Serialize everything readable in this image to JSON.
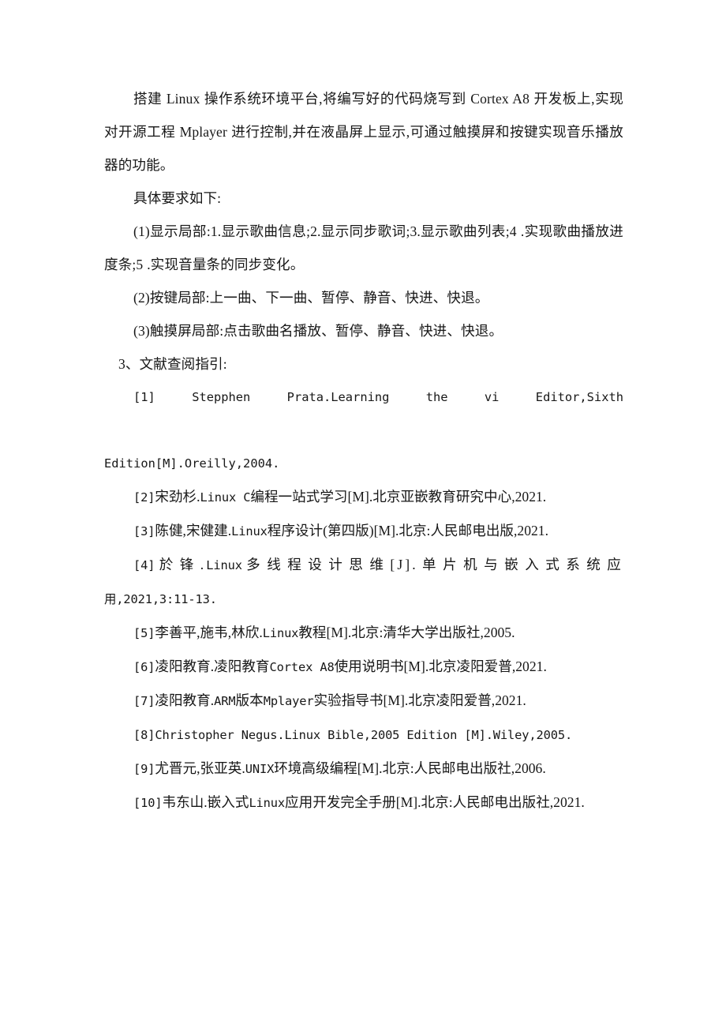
{
  "document": {
    "type": "academic-task-specification",
    "language": "zh-CN",
    "page_background": "#ffffff",
    "text_color": "#171717"
  },
  "body": {
    "intro_paragraph": "搭建 Linux 操作系统环境平台,将编写好的代码烧写到 Cortex A8 开发板上,实现对开源工程 Mplayer 进行控制,并在液晶屏上显示,可通过触摸屏和按键实现音乐播放器的功能。",
    "requirements_heading": "具体要求如下:",
    "requirements": [
      "(1)显示局部:1.显示歌曲信息;2.显示同步歌词;3.显示歌曲列表;4 .实现歌曲播放进度条;5 .实现音量条的同步变化。",
      "(2)按键局部:上一曲、下一曲、暂停、静音、快进、快退。",
      "(3)触摸屏局部:点击歌曲名播放、暂停、静音、快进、快退。"
    ],
    "references_heading": "3、文献查阅指引:",
    "references": [
      {
        "marker": "[1]",
        "line1": "Stepphen Prata.Learning the vi Editor,Sixth",
        "line2": "Edition[M].Oreilly,2004.",
        "justified_wide": true
      },
      {
        "marker": "[2]",
        "text_cjk_a": "宋劲杉.",
        "text_latin": "Linux C",
        "text_cjk_b": "编程一站式学习[M].北京亚嵌教育研究中心,2021."
      },
      {
        "marker": "[3]",
        "text_cjk_a": "陈健,宋健建.",
        "text_latin": "Linux",
        "text_cjk_b": "程序设计(第四版)[M].北京:人民邮电出版,2021."
      },
      {
        "marker": "[4]",
        "line1_cjk_a": "於锋.",
        "line1_latin": "Linux",
        "line1_cjk_b": "多线程设计思维[J].单片机与嵌入式系统应",
        "line2": "用,2021,3:11-13.",
        "letter_spaced": true
      },
      {
        "marker": "[5]",
        "text_cjk_a": "李善平,施韦,林欣.",
        "text_latin": "Linux",
        "text_cjk_b": "教程[M].北京:清华大学出版社,2005."
      },
      {
        "marker": "[6]",
        "text_cjk_a": "凌阳教育.凌阳教育",
        "text_latin": "Cortex A8",
        "text_cjk_b": "使用说明书[M].北京凌阳爱普,2021."
      },
      {
        "marker": "[7]",
        "text_cjk_a": "凌阳教育.",
        "text_latin": "ARM",
        "text_cjk_b": "版本",
        "text_latin_2": "Mplayer",
        "text_cjk_c": "实验指导书[M].北京凌阳爱普,2021."
      },
      {
        "marker": "[8]",
        "text_latin": "Christopher Negus.Linux Bible,2005 Edition [M].Wiley,2005.",
        "all_latin": true
      },
      {
        "marker": "[9]",
        "text_cjk_a": "尤晋元,张亚英.",
        "text_latin": "UNIX",
        "text_cjk_b": "环境高级编程[M].北京:人民邮电出版社,2006."
      },
      {
        "marker": "[10]",
        "line1_cjk_a": "韦东山.嵌入式",
        "line1_latin": "Linux",
        "line1_cjk_b": "应用开发完全手册[M].北京:人民邮电出版",
        "line2": "社,2021."
      }
    ]
  }
}
